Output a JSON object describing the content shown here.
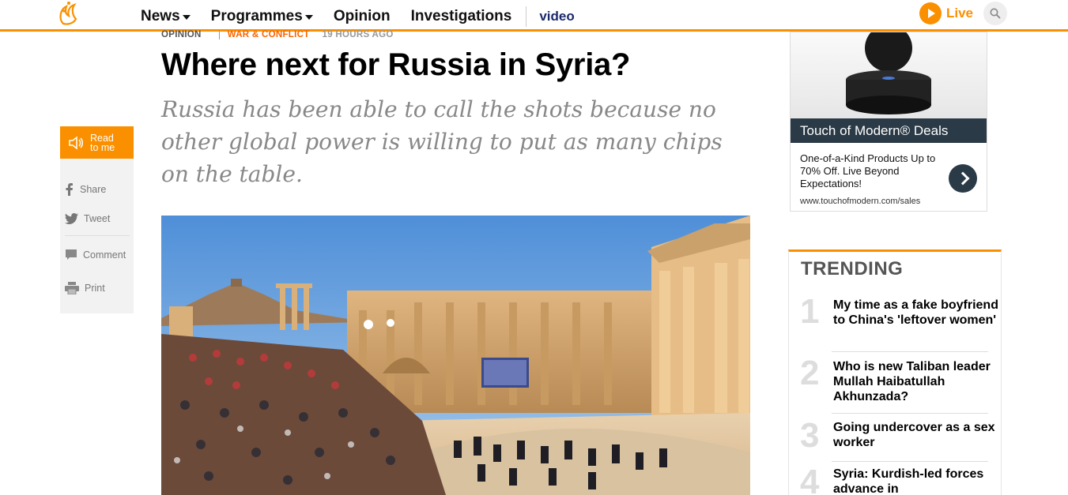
{
  "header": {
    "logo_icon": "aljazeera-logo-icon",
    "nav": [
      {
        "label": "News",
        "dropdown": true
      },
      {
        "label": "Programmes",
        "dropdown": true
      },
      {
        "label": "Opinion",
        "dropdown": false
      },
      {
        "label": "Investigations",
        "dropdown": false
      }
    ],
    "video_label": "video",
    "live_label": "Live",
    "accent_color": "#fa9000"
  },
  "article": {
    "category": "OPINION",
    "topic": "WAR & CONFLICT",
    "time": "19 HOURS AGO",
    "headline": "Where next for Russia in Syria?",
    "standfirst": "Russia has been able to call the shots because no other global power is willing to put as many chips on the table."
  },
  "social": {
    "read_label_1": "Read",
    "read_label_2": "to me",
    "share": "Share",
    "tweet": "Tweet",
    "comment": "Comment",
    "print": "Print"
  },
  "ad": {
    "title": "Touch of Modern® Deals",
    "description": "One-of-a-Kind Products Up to 70% Off. Live Beyond Expectations!",
    "url": "www.touchofmodern.com/sales"
  },
  "trending": {
    "title": "TRENDING",
    "items": [
      {
        "num": "1",
        "text": "My time as a fake boyfriend to China's 'leftover women'"
      },
      {
        "num": "2",
        "text": "Who is new Taliban leader Mullah Haibatullah Akhunzada?"
      },
      {
        "num": "3",
        "text": "Going undercover as a sex worker"
      },
      {
        "num": "4",
        "text": "Syria: Kurdish-led forces advance in"
      }
    ]
  }
}
